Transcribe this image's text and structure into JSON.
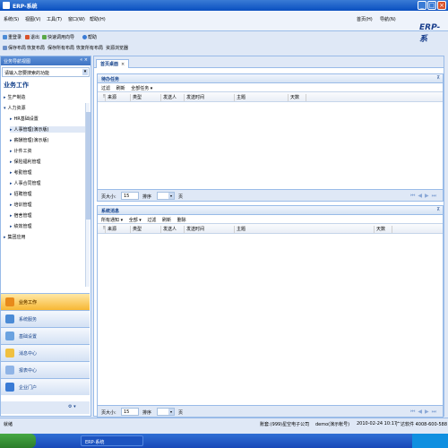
{
  "window": {
    "title": "ERP-系统"
  },
  "menu": [
    "系统(S)",
    "视图(V)",
    "工具(T)",
    "窗口(W)",
    "帮助(H)"
  ],
  "menu_right": [
    "首页(H)",
    "导航(N)"
  ],
  "brand_logo": "ERP-系",
  "toolbar1": [
    "重登录",
    "退出",
    "快速调用向导",
    "帮助"
  ],
  "toolbar2": [
    "保存布局",
    "恢复布局",
    "保存所有布局",
    "恢复所有布局",
    "资源浏览器"
  ],
  "sidebar": {
    "header": "业务导航视图",
    "search_placeholder": "请输入您要搜索的功能",
    "group_title": "业务工作",
    "tree": [
      "生产制造",
      "人力资源",
      "HR基础设置",
      "人事管理(演示版)",
      "薪酬管理(演示版)",
      "计件工资",
      "保险福利管理",
      "考勤管理",
      "人事合同管理",
      "招聘管理",
      "培训管理",
      "宿舍管理",
      "绩效管理",
      "集团应用"
    ],
    "accordion": [
      "业务工作",
      "系统服务",
      "基础设置",
      "消息中心",
      "报表中心",
      "企业门户"
    ]
  },
  "tabs": [
    "首页桌面"
  ],
  "todo_panel": {
    "title": "待办任务",
    "toolbar": [
      "过滤",
      "刷新",
      "全部任务 ▾"
    ],
    "columns": [
      "来源",
      "类型",
      "发送人",
      "发送时间",
      "主题",
      "天数"
    ]
  },
  "msg_panel": {
    "title": "系统消息",
    "toolbar": [
      "所有通知 ▾",
      "全部 ▾",
      "过滤",
      "刷新",
      "删除"
    ],
    "columns": [
      "来源",
      "类型",
      "发送人",
      "发送时间",
      "主题",
      "天数"
    ]
  },
  "pager": {
    "size_label": "页大小:",
    "size_value": "15",
    "sort_label": "排序",
    "page_label": "页"
  },
  "status": {
    "left": "就绪",
    "account": "账套:(999)星空电子公司",
    "user": "demo(演示帐号)",
    "datetime": "2010-02-24 10:17",
    "hotline": "广达软件 4008-600-588"
  },
  "taskbar": {
    "task": "ERP-系统"
  }
}
